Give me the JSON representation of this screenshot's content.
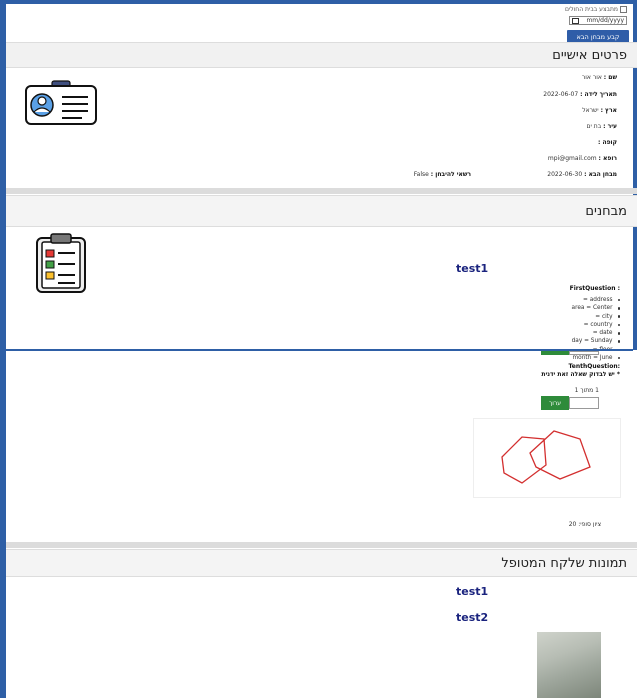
{
  "top": {
    "checkbox_label": "מתבצע בבית החולים",
    "date_placeholder": "mm/dd/yyyy",
    "set_next_exam_button": "קבע מבחן הבא"
  },
  "personal": {
    "title": "פרטים אישיים",
    "fields": [
      {
        "label": "שם :",
        "value": "אור אור"
      },
      {
        "label": "תאריך לידה :",
        "value": "2022-06-07"
      },
      {
        "label": "ארץ :",
        "value": "ישראל"
      },
      {
        "label": "עיר :",
        "value": "בת ים"
      },
      {
        "label": "קופה :",
        "value": ""
      },
      {
        "label": "רופא :",
        "value": "mpi@gmail.com"
      },
      {
        "label": "מבחן הבא :",
        "value": "2022-06-30"
      }
    ],
    "allowed_label": "רשאי להיבחן :",
    "allowed_value": "False",
    "icon": "id-card-icon"
  },
  "exams": {
    "title": "מבחנים",
    "test_name": "test1",
    "first_question_label": ": FirstQuestion",
    "answers": [
      "= address",
      "area = Center",
      "= city",
      "= country",
      "= date",
      "day = Sunday",
      "= floor",
      "month = June"
    ],
    "icon": "clipboard-checklist-icon",
    "tenth_question_label": ":TenthQuestion",
    "tenth_question_text": "* יש לבדוק שאלה זאת ידנית",
    "score_of": "1 מתוך 1",
    "edit_button": "ערוך",
    "total_score": "ציון סופי: 20"
  },
  "photos": {
    "title": "תמונות שלקח המטופל",
    "tests": [
      "test1",
      "test2"
    ]
  },
  "colors": {
    "frame_blue": "#2e5fa6",
    "button_blue": "#2f5da8",
    "button_green": "#2e8b3a",
    "heading_navy": "#1a237e",
    "drawing_red": "#d32f2f"
  }
}
